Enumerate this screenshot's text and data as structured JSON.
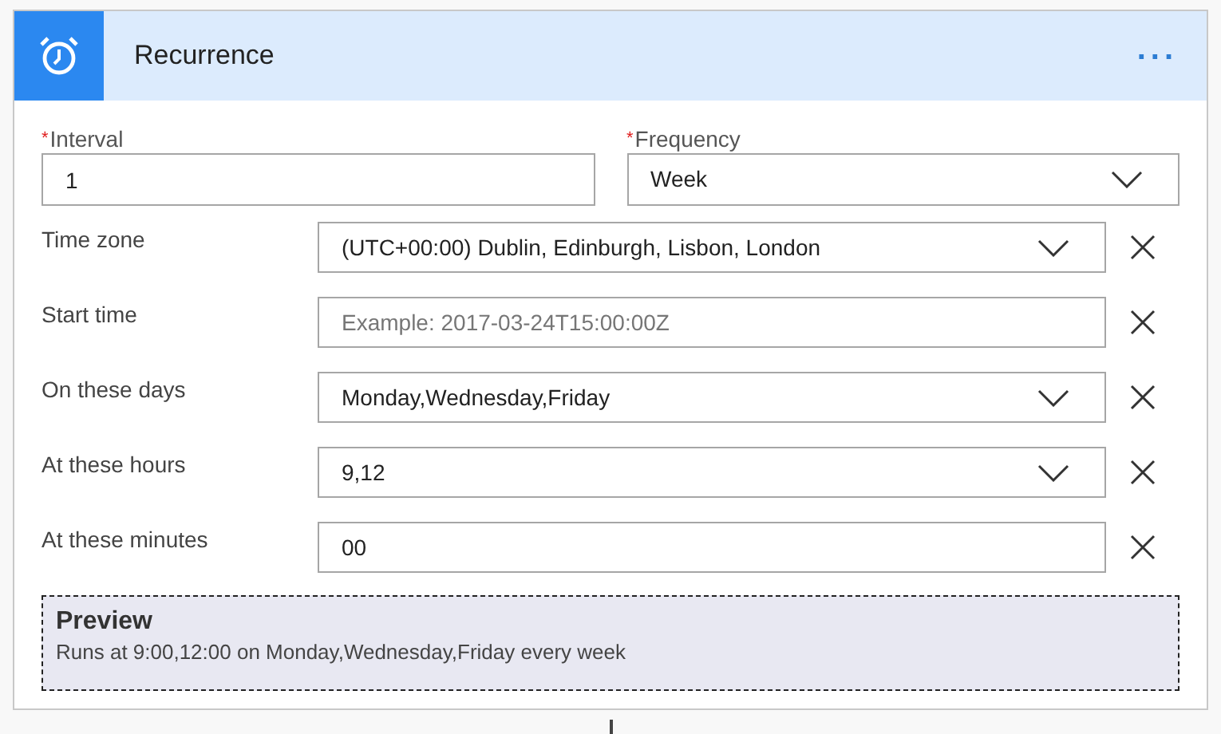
{
  "card": {
    "title": "Recurrence",
    "menu": "..."
  },
  "required_fields": [
    {
      "label": "Interval",
      "required_mark": "*",
      "kind": "text",
      "value": "1"
    },
    {
      "label": "Frequency",
      "required_mark": "*",
      "kind": "dropdown",
      "value": "Week"
    }
  ],
  "fields": [
    {
      "label": "Time zone",
      "kind": "dropdown",
      "value": "(UTC+00:00) Dublin, Edinburgh, Lisbon, London"
    },
    {
      "label": "Start time",
      "kind": "text",
      "placeholder": "Example: 2017-03-24T15:00:00Z"
    },
    {
      "label": "On these days",
      "kind": "dropdown",
      "value": "Monday,Wednesday,Friday"
    },
    {
      "label": "At these hours",
      "kind": "dropdown",
      "value": "9,12"
    },
    {
      "label": "At these minutes",
      "kind": "text",
      "value": "00"
    }
  ],
  "preview": {
    "title": "Preview",
    "text": "Runs at 9:00,12:00 on Monday,Wednesday,Friday every week"
  }
}
